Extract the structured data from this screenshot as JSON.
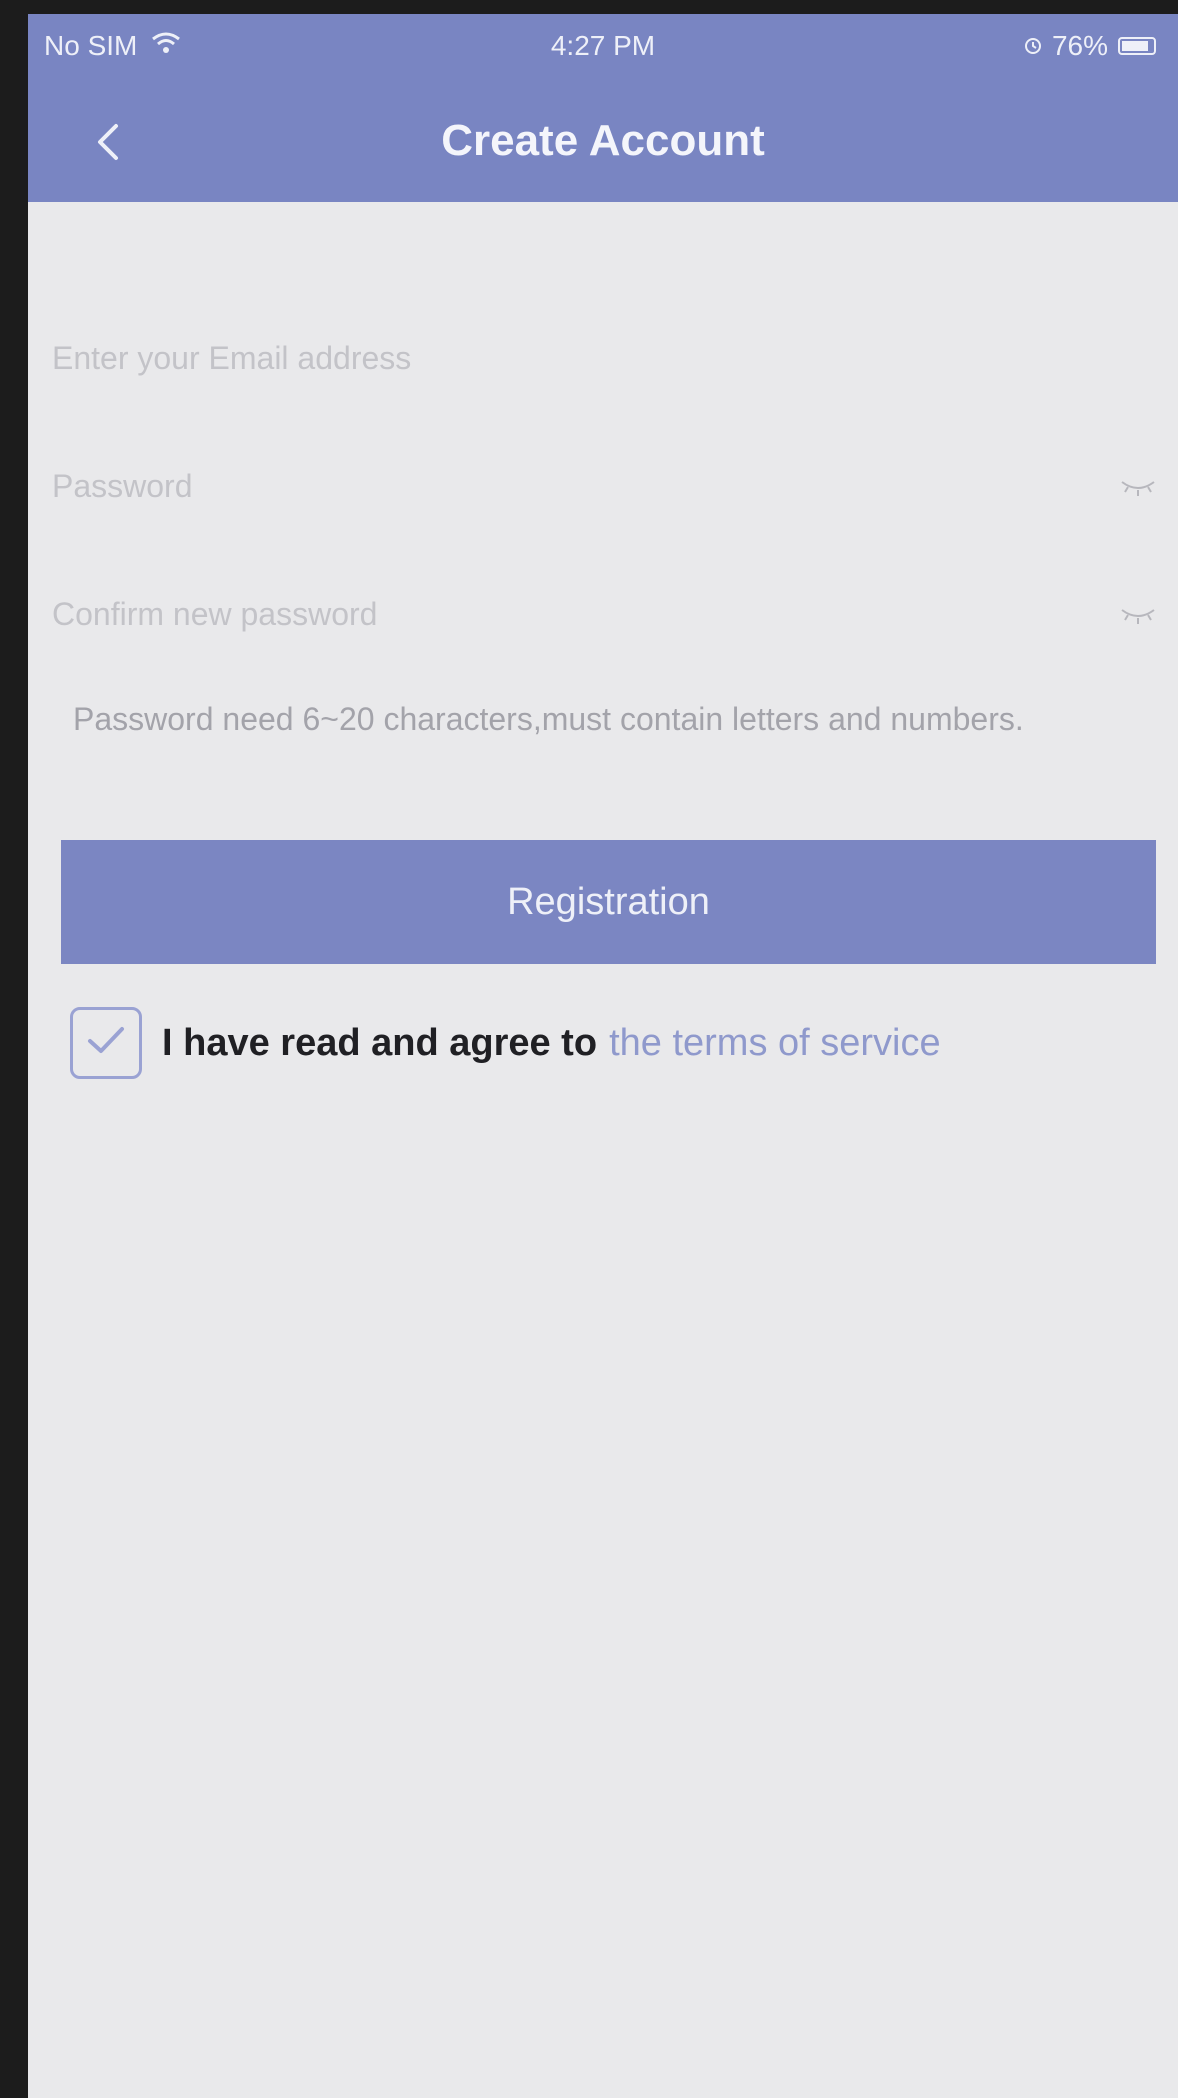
{
  "status_bar": {
    "carrier": "No SIM",
    "time": "4:27 PM",
    "battery": "76%",
    "battery_level": 0.76
  },
  "header": {
    "title": "Create Account",
    "back_icon": "chevron-left-icon"
  },
  "form": {
    "email_placeholder": "Enter your Email address",
    "password_placeholder": "Password",
    "confirm_placeholder": "Confirm new password",
    "hint": "Password need 6~20 characters,must contain letters and numbers."
  },
  "register_button": "Registration",
  "agreement": {
    "checked": true,
    "text": "I have read and agree to",
    "link": "the terms of service"
  },
  "colors": {
    "header_bg": "#7985c2",
    "button_bg": "#7b86c2",
    "link": "#8f99cc",
    "page_bg": "#e9e9eb"
  }
}
